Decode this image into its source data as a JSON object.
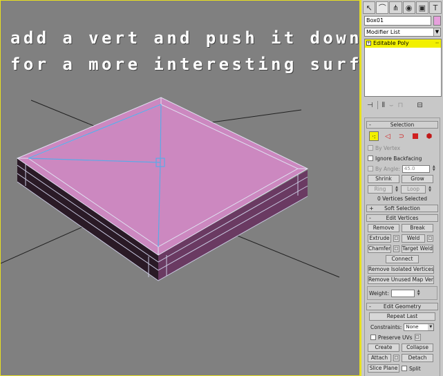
{
  "viewport": {
    "overlay_line1": "add a vert and push it down a bit",
    "overlay_line2": "for a more interesting surface"
  },
  "command_panel": {
    "tab_icons": [
      "select-cursor-icon",
      "modify-curve-icon",
      "hierarchy-icon",
      "motion-icon",
      "display-icon",
      "utilities-hammer-icon"
    ],
    "object_name": "Box01",
    "object_color": "#e6a0dc",
    "modifier_list_label": "Modifier List",
    "stack_item": "Editable Poly",
    "selection": {
      "title": "Selection",
      "by_vertex": "By Vertex",
      "ignore_backfacing": "Ignore Backfacing",
      "by_angle": "By Angle:",
      "by_angle_value": "45.0",
      "shrink": "Shrink",
      "grow": "Grow",
      "ring": "Ring",
      "loop": "Loop",
      "status": "0 Vertices Selected"
    },
    "soft_selection": {
      "title": "Soft Selection"
    },
    "edit_vertices": {
      "title": "Edit Vertices",
      "remove": "Remove",
      "break": "Break",
      "extrude": "Extrude",
      "weld": "Weld",
      "chamfer": "Chamfer",
      "target_weld": "Target Weld",
      "connect": "Connect",
      "remove_isolated": "Remove Isolated Vertices",
      "remove_unused": "Remove Unused Map Verts",
      "weight_label": "Weight:"
    },
    "edit_geometry": {
      "title": "Edit Geometry",
      "repeat_last": "Repeat Last",
      "constraints_label": "Constraints:",
      "constraints_value": "None",
      "preserve_uvs": "Preserve UVs",
      "create": "Create",
      "collapse": "Collapse",
      "attach": "Attach",
      "detach": "Detach",
      "slice_plane": "Slice Plane",
      "split": "Split"
    }
  }
}
